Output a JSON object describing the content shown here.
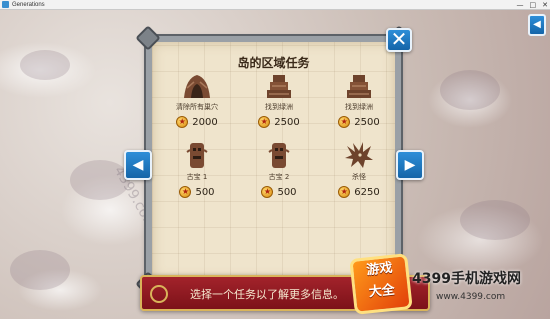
{
  "window": {
    "title": "Generations",
    "controls": [
      "—",
      "□",
      "✕"
    ]
  },
  "panel": {
    "title": "岛的区域任务"
  },
  "quests": [
    {
      "name": "清除所有巢穴",
      "reward": "2000",
      "icon": "cave-icon"
    },
    {
      "name": "找到绿洲",
      "reward": "2500",
      "icon": "ruins-icon"
    },
    {
      "name": "找到绿洲",
      "reward": "2500",
      "icon": "ruins-icon"
    },
    {
      "name": "古宝 1",
      "reward": "500",
      "icon": "totem-icon"
    },
    {
      "name": "古宝 2",
      "reward": "500",
      "icon": "totem-icon"
    },
    {
      "name": "杀怪",
      "reward": "6250",
      "icon": "monster-icon"
    }
  ],
  "buttons": {
    "close": "✕",
    "prev": "◀",
    "next": "▶",
    "corner": "◀"
  },
  "banner": {
    "text": "选择一个任务以了解更多信息。"
  },
  "watermark": {
    "logo_line1": "游戏",
    "logo_line2": "大全",
    "site": "4399手机游戏网",
    "url": "www.4399.com",
    "side": "4399.com"
  },
  "colors": {
    "accent": "#1f7ac4",
    "banner": "#8f1a22",
    "parchment": "#efe4cc"
  }
}
